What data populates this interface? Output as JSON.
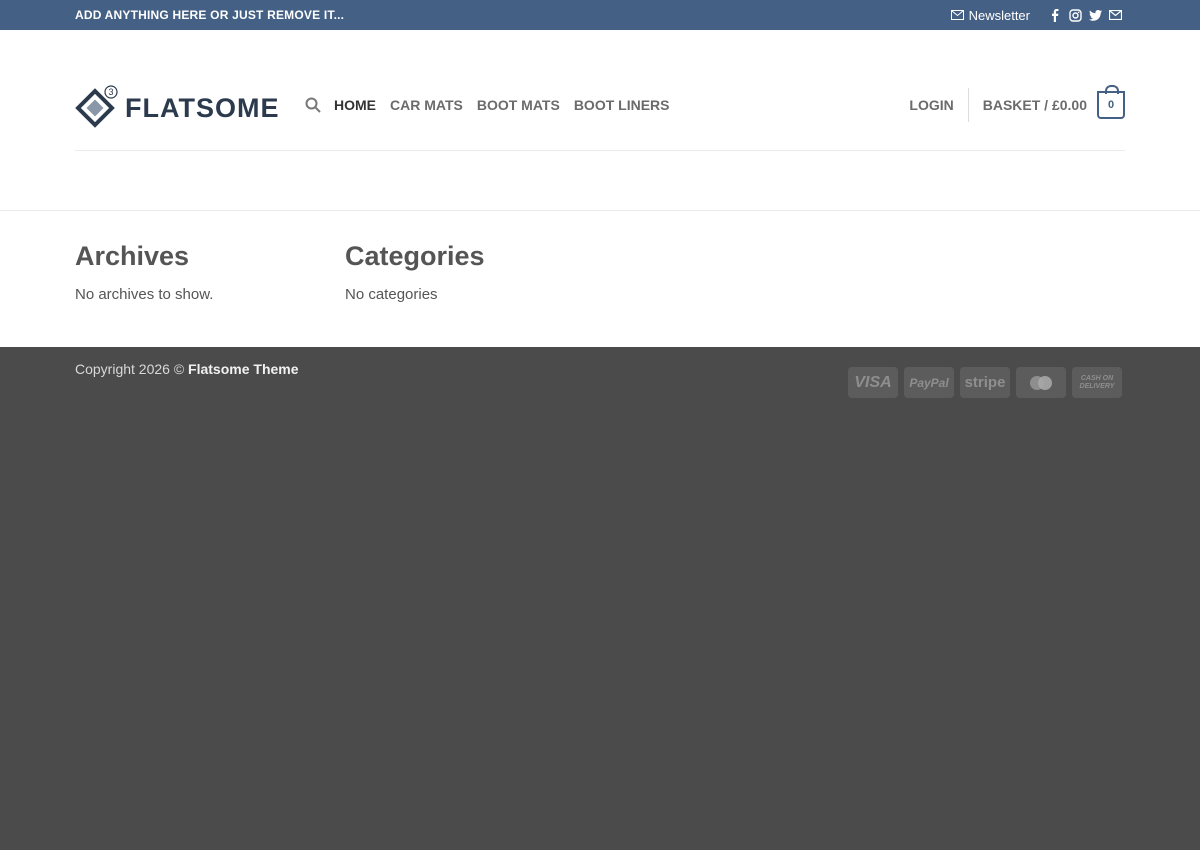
{
  "topbar": {
    "message": "ADD ANYTHING HERE OR JUST REMOVE IT...",
    "newsletter_label": "Newsletter",
    "social_icons": [
      "facebook-icon",
      "instagram-icon",
      "twitter-icon",
      "email-icon"
    ]
  },
  "header": {
    "logo_text": "FLATSOME",
    "logo_badge": "3",
    "nav": [
      "HOME",
      "CAR MATS",
      "BOOT MATS",
      "BOOT LINERS"
    ],
    "login_label": "LOGIN",
    "basket_label": "BASKET / £0.00",
    "cart_count": "0"
  },
  "widgets": {
    "archives": {
      "title": "Archives",
      "text": "No archives to show."
    },
    "categories": {
      "title": "Categories",
      "text": "No categories"
    }
  },
  "footer": {
    "copyright_prefix": "Copyright 2026 ©",
    "copyright_name": "Flatsome Theme",
    "payments": [
      "VISA",
      "PayPal",
      "stripe",
      "MasterCard",
      "CASH ON DELIVERY"
    ]
  },
  "colors": {
    "topbar": "#446084",
    "footer": "#4b4b4b",
    "accent": "#446084"
  }
}
